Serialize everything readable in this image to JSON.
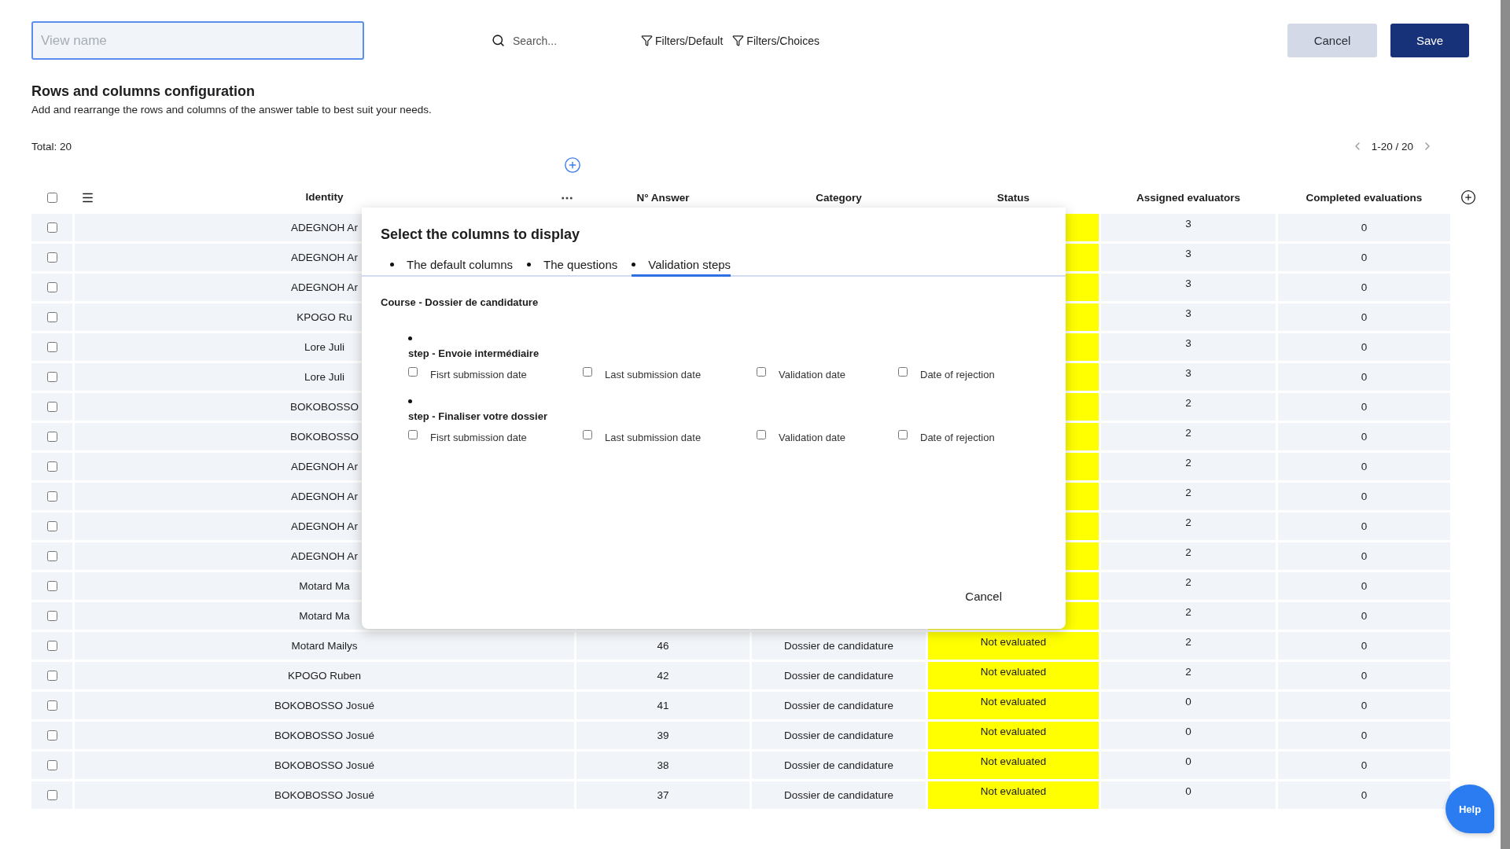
{
  "top_bar": {
    "view_name": {
      "placeholder": "View name"
    },
    "search": {
      "placeholder": "Search..."
    },
    "filters": [
      "Filters/Default",
      "Filters/Choices"
    ],
    "buttons": [
      {
        "label": "Cancel",
        "kind": "secondary"
      },
      {
        "label": "Save",
        "kind": "primary"
      }
    ]
  },
  "section": {
    "title": "Rows and columns configuration",
    "description": "Add and rearrange the rows and columns of the answer table to best suit your needs."
  },
  "total": "Total: 20",
  "pagination": "1-20 / 20",
  "table": {
    "select_all": {
      "checked": false
    },
    "columns": [
      "Identity",
      "N° Answer",
      "Category",
      "Status",
      "Assigned evaluators",
      "Completed evaluations"
    ],
    "rows": [
      {
        "checked": false,
        "identity": "ADEGNOH Ar",
        "assigned": "3",
        "completed": "0"
      },
      {
        "checked": false,
        "identity": "ADEGNOH Ar",
        "assigned": "3",
        "completed": "0"
      },
      {
        "checked": false,
        "identity": "ADEGNOH Ar",
        "assigned": "3",
        "completed": "0"
      },
      {
        "checked": false,
        "identity": "KPOGO Ru",
        "assigned": "3",
        "completed": "0"
      },
      {
        "checked": false,
        "identity": "Lore Juli",
        "assigned": "3",
        "completed": "0"
      },
      {
        "checked": false,
        "identity": "Lore Juli",
        "assigned": "3",
        "completed": "0"
      },
      {
        "checked": false,
        "identity": "BOKOBOSSO",
        "assigned": "2",
        "completed": "0"
      },
      {
        "checked": false,
        "identity": "BOKOBOSSO",
        "assigned": "2",
        "completed": "0"
      },
      {
        "checked": false,
        "identity": "ADEGNOH Ar",
        "assigned": "2",
        "completed": "0"
      },
      {
        "checked": false,
        "identity": "ADEGNOH Ar",
        "assigned": "2",
        "completed": "0"
      },
      {
        "checked": false,
        "identity": "ADEGNOH Ar",
        "assigned": "2",
        "completed": "0"
      },
      {
        "checked": false,
        "identity": "ADEGNOH Ar",
        "assigned": "2",
        "completed": "0"
      },
      {
        "checked": false,
        "identity": "Motard Ma",
        "assigned": "2",
        "completed": "0"
      },
      {
        "checked": false,
        "identity": "Motard Ma",
        "assigned": "2",
        "completed": "0"
      },
      {
        "checked": false,
        "identity": "Motard Mailys",
        "answer": "46",
        "category": "Dossier de candidature",
        "status": "Not evaluated",
        "assigned": "2",
        "completed": "0"
      },
      {
        "checked": false,
        "identity": "KPOGO Ruben",
        "answer": "42",
        "category": "Dossier de candidature",
        "status": "Not evaluated",
        "assigned": "2",
        "completed": "0"
      },
      {
        "checked": false,
        "identity": "BOKOBOSSO Josué",
        "answer": "41",
        "category": "Dossier de candidature",
        "status": "Not evaluated",
        "assigned": "0",
        "completed": "0"
      },
      {
        "checked": false,
        "identity": "BOKOBOSSO Josué",
        "answer": "39",
        "category": "Dossier de candidature",
        "status": "Not evaluated",
        "assigned": "0",
        "completed": "0"
      },
      {
        "checked": false,
        "identity": "BOKOBOSSO Josué",
        "answer": "38",
        "category": "Dossier de candidature",
        "status": "Not evaluated",
        "assigned": "0",
        "completed": "0"
      },
      {
        "checked": false,
        "identity": "BOKOBOSSO Josué",
        "answer": "37",
        "category": "Dossier de candidature",
        "status": "Not evaluated",
        "assigned": "0",
        "completed": "0"
      }
    ]
  },
  "dialog": {
    "title": "Select the columns to display",
    "tabs": [
      {
        "label": "The default columns",
        "selected": false
      },
      {
        "label": "The questions",
        "selected": false
      },
      {
        "label": "Validation steps",
        "selected": true
      }
    ],
    "course": "Course - Dossier de candidature",
    "steps": [
      {
        "title": "step - Envoie intermédiaire",
        "options": [
          {
            "label": "Fisrt submission date",
            "checked": false
          },
          {
            "label": "Last submission date",
            "checked": false
          },
          {
            "label": "Validation date",
            "checked": false
          },
          {
            "label": "Date of rejection",
            "checked": false
          }
        ]
      },
      {
        "title": "step - Finaliser votre dossier",
        "options": [
          {
            "label": "Fisrt submission date",
            "checked": false
          },
          {
            "label": "Last submission date",
            "checked": false
          },
          {
            "label": "Validation date",
            "checked": false
          },
          {
            "label": "Date of rejection",
            "checked": false
          }
        ]
      }
    ],
    "cancel": "Cancel"
  },
  "help": "Help"
}
